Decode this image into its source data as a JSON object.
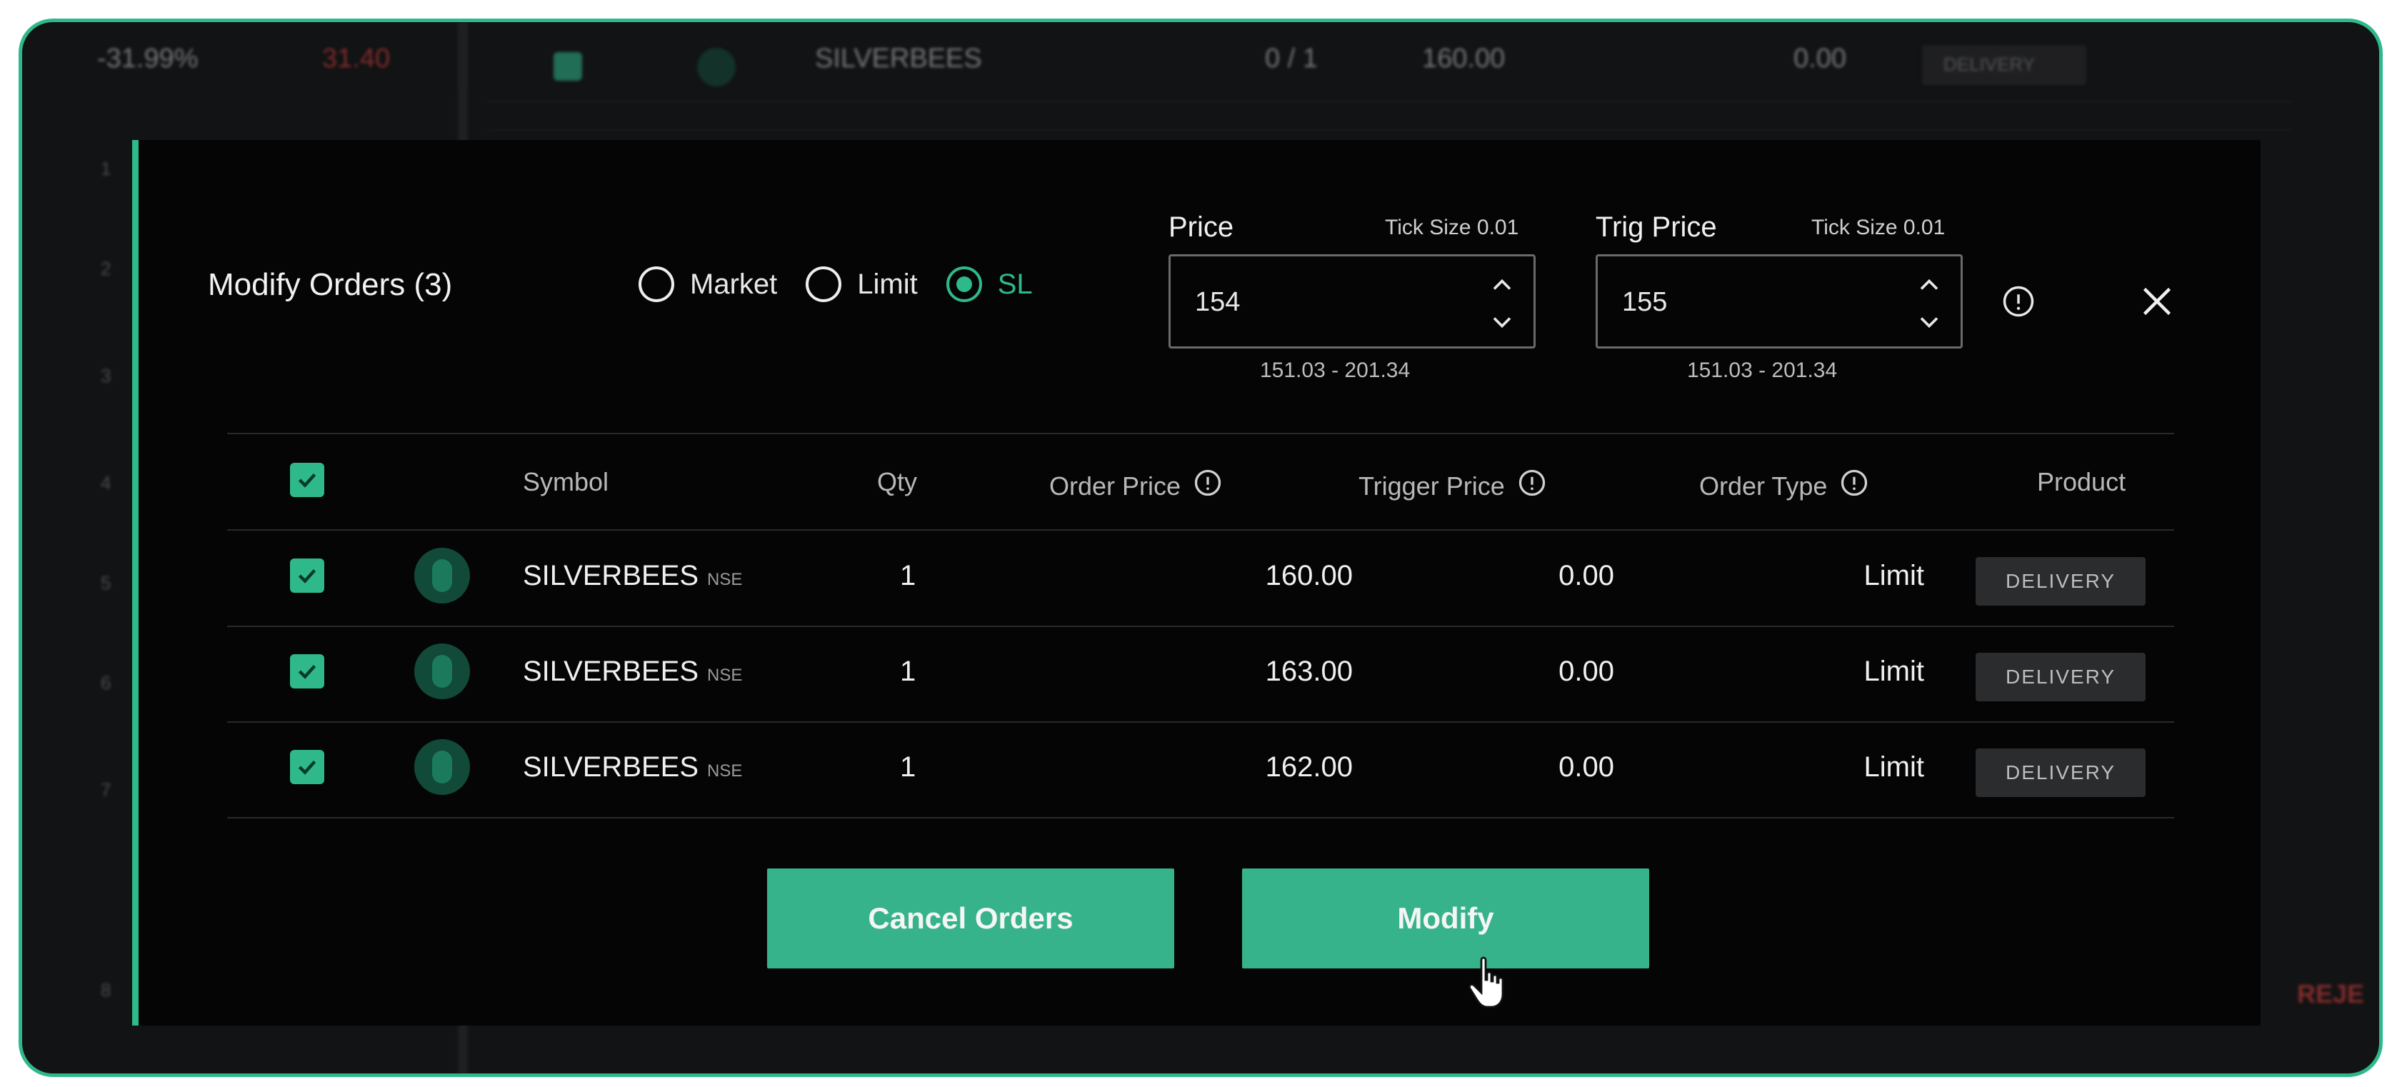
{
  "background": {
    "top_row": {
      "left_value": "-31.99%",
      "red_value": "31.40",
      "symbol": "SILVERBEES",
      "qty": "0 / 1",
      "price": "160.00",
      "trigger": "0.00",
      "product": "DELIVERY"
    },
    "side_ticks": [
      "1",
      "2",
      "3",
      "4",
      "5",
      "6",
      "7",
      "8"
    ],
    "right_red_text": "REJE"
  },
  "modal": {
    "title": "Modify Orders (3)",
    "order_types": [
      {
        "label": "Market",
        "selected": false
      },
      {
        "label": "Limit",
        "selected": false
      },
      {
        "label": "SL",
        "selected": true
      }
    ],
    "price": {
      "label": "Price",
      "tick_hint": "Tick Size 0.01",
      "value": "154",
      "range": "151.03 - 201.34"
    },
    "trig_price": {
      "label": "Trig Price",
      "tick_hint": "Tick Size 0.01",
      "value": "155",
      "range": "151.03 - 201.34"
    },
    "icons": {
      "info": "info-icon",
      "close": "close-icon",
      "stepper_up": "chevron-up-icon",
      "stepper_down": "chevron-down-icon"
    },
    "table": {
      "headers": {
        "symbol": "Symbol",
        "qty": "Qty",
        "order_price": "Order Price",
        "trigger_price": "Trigger Price",
        "order_type": "Order Type",
        "product": "Product"
      },
      "rows": [
        {
          "symbol": "SILVERBEES",
          "suffix": "NSE",
          "qty": "1",
          "order_price": "160.00",
          "trigger_price": "0.00",
          "order_type": "Limit",
          "product": "DELIVERY"
        },
        {
          "symbol": "SILVERBEES",
          "suffix": "NSE",
          "qty": "1",
          "order_price": "163.00",
          "trigger_price": "0.00",
          "order_type": "Limit",
          "product": "DELIVERY"
        },
        {
          "symbol": "SILVERBEES",
          "suffix": "NSE",
          "qty": "1",
          "order_price": "162.00",
          "trigger_price": "0.00",
          "order_type": "Limit",
          "product": "DELIVERY"
        }
      ]
    },
    "buttons": {
      "cancel": "Cancel Orders",
      "modify": "Modify"
    }
  },
  "colors": {
    "accent": "#2fb98a",
    "modal_bg": "#050505",
    "page_bg": "#121314",
    "danger": "#e04040"
  }
}
